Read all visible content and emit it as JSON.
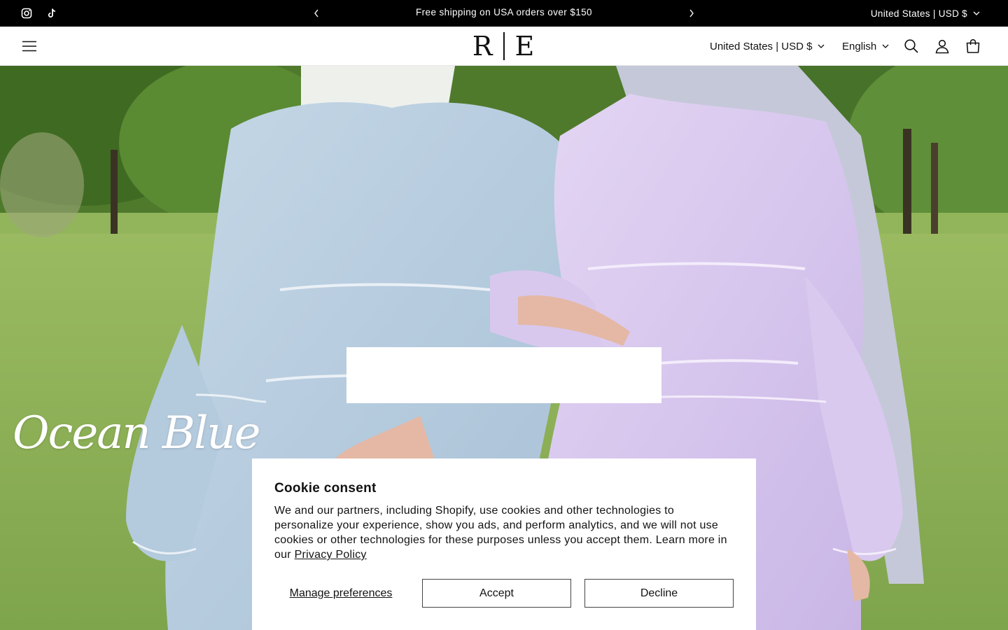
{
  "announcement": {
    "message": "Free shipping on USA orders over $150",
    "locale": "United States | USD $",
    "social": [
      "instagram-icon",
      "tiktok-icon"
    ]
  },
  "header": {
    "logo_left": "R",
    "logo_right": "E",
    "country": "United States | USD $",
    "language": "English",
    "icons": [
      "menu-icon",
      "search-icon",
      "account-icon",
      "cart-icon"
    ]
  },
  "hero": {
    "title": "Ocean Blue"
  },
  "cookie": {
    "title": "Cookie consent",
    "body": "We and our partners, including Shopify, use cookies and other technologies to personalize your experience, show you ads, and perform analytics, and we will not use cookies or other technologies for these purposes unless you accept them. Learn more in our ",
    "link": "Privacy Policy",
    "manage": "Manage preferences",
    "accept": "Accept",
    "decline": "Decline"
  },
  "colors": {
    "announcement_bg": "#000000",
    "dress_left": "#b9cfe0",
    "dress_right": "#d8c8ee",
    "grass": "#8db35a"
  }
}
